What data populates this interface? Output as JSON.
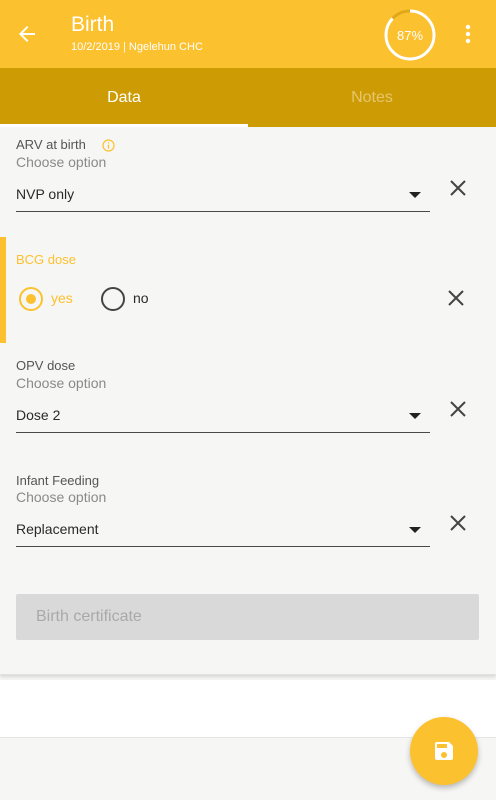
{
  "appbar": {
    "title": "Birth",
    "subtitle": "10/2/2019 | Ngelehun CHC",
    "progress_text": "87%",
    "progress_fraction": 0.87,
    "accent_color": "#fcc12f"
  },
  "tabs": [
    {
      "label": "Data",
      "selected": true
    },
    {
      "label": "Notes",
      "selected": false
    }
  ],
  "fields": {
    "arv": {
      "label": "ARV at birth",
      "hint": "Choose option",
      "value": "NVP only"
    },
    "bcg": {
      "label": "BCG dose",
      "option_yes": "yes",
      "option_no": "no",
      "selected": "yes"
    },
    "opv": {
      "label": "OPV dose",
      "hint": "Choose option",
      "value": "Dose 2"
    },
    "feeding": {
      "label": "Infant Feeding",
      "hint": "Choose option",
      "value": "Replacement"
    }
  },
  "buttons": {
    "birth_certificate": "Birth certificate"
  },
  "icons": {
    "back": "arrow-left-icon",
    "more": "more-vert-icon",
    "info": "info-icon",
    "clear": "close-icon",
    "dropdown": "caret-down-icon",
    "save": "save-icon"
  }
}
